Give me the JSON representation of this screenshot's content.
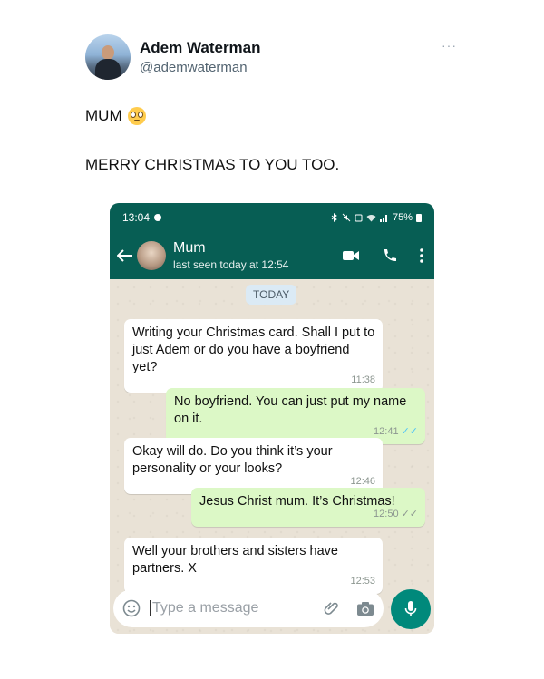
{
  "tweet": {
    "display_name": "Adem Waterman",
    "handle": "@ademwaterman",
    "more_label": "···",
    "line1": "MUM",
    "line2": "MERRY CHRISTMAS TO YOU TOO."
  },
  "phone": {
    "status_time": "13:04",
    "battery": "75%",
    "contact_name": "Mum",
    "last_seen": "last seen today at 12:54",
    "date_chip": "TODAY",
    "input_placeholder": "Type a message",
    "colors": {
      "header": "#075e54",
      "outgoing": "#dcf8c6",
      "incoming": "#ffffff",
      "mic": "#00897b"
    },
    "messages": [
      {
        "direction": "in",
        "text": "Writing your Christmas card. Shall I put to just Adem or do you have a boyfriend yet?",
        "time": "11:38"
      },
      {
        "direction": "out",
        "text": "No boyfriend. You can just put my name on it.",
        "time": "12:41",
        "status": "read"
      },
      {
        "direction": "in",
        "text": "Okay will do. Do you think it’s your personality or your looks?",
        "time": "12:46"
      },
      {
        "direction": "out",
        "text": "Jesus Christ mum. It’s Christmas!",
        "time": "12:50",
        "status": "delivered"
      },
      {
        "direction": "in",
        "text": "Well your brothers and sisters have partners. X",
        "time": "12:53"
      }
    ]
  }
}
